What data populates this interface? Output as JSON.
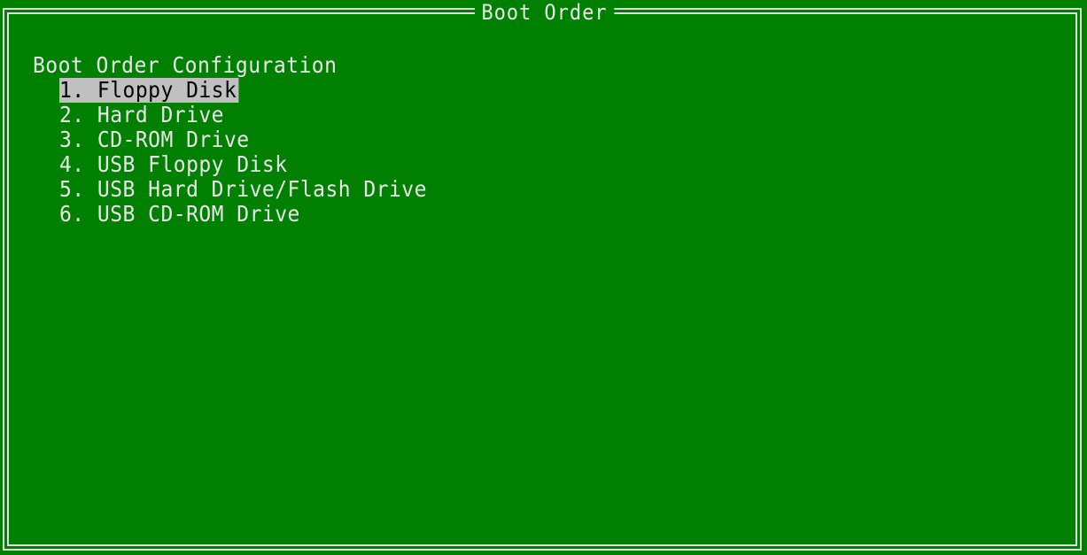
{
  "window": {
    "title": "Boot Order"
  },
  "main": {
    "heading": "Boot Order Configuration",
    "items": [
      {
        "label": "1. Floppy Disk",
        "selected": true
      },
      {
        "label": "2. Hard Drive",
        "selected": false
      },
      {
        "label": "3. CD-ROM Drive",
        "selected": false
      },
      {
        "label": "4. USB Floppy Disk",
        "selected": false
      },
      {
        "label": "5. USB Hard Drive/Flash Drive",
        "selected": false
      },
      {
        "label": "6. USB CD-ROM Drive",
        "selected": false
      }
    ]
  },
  "colors": {
    "background": "#008000",
    "text": "#e8e8e8",
    "highlight_background": "#c0c0c0",
    "highlight_text": "#000000"
  }
}
